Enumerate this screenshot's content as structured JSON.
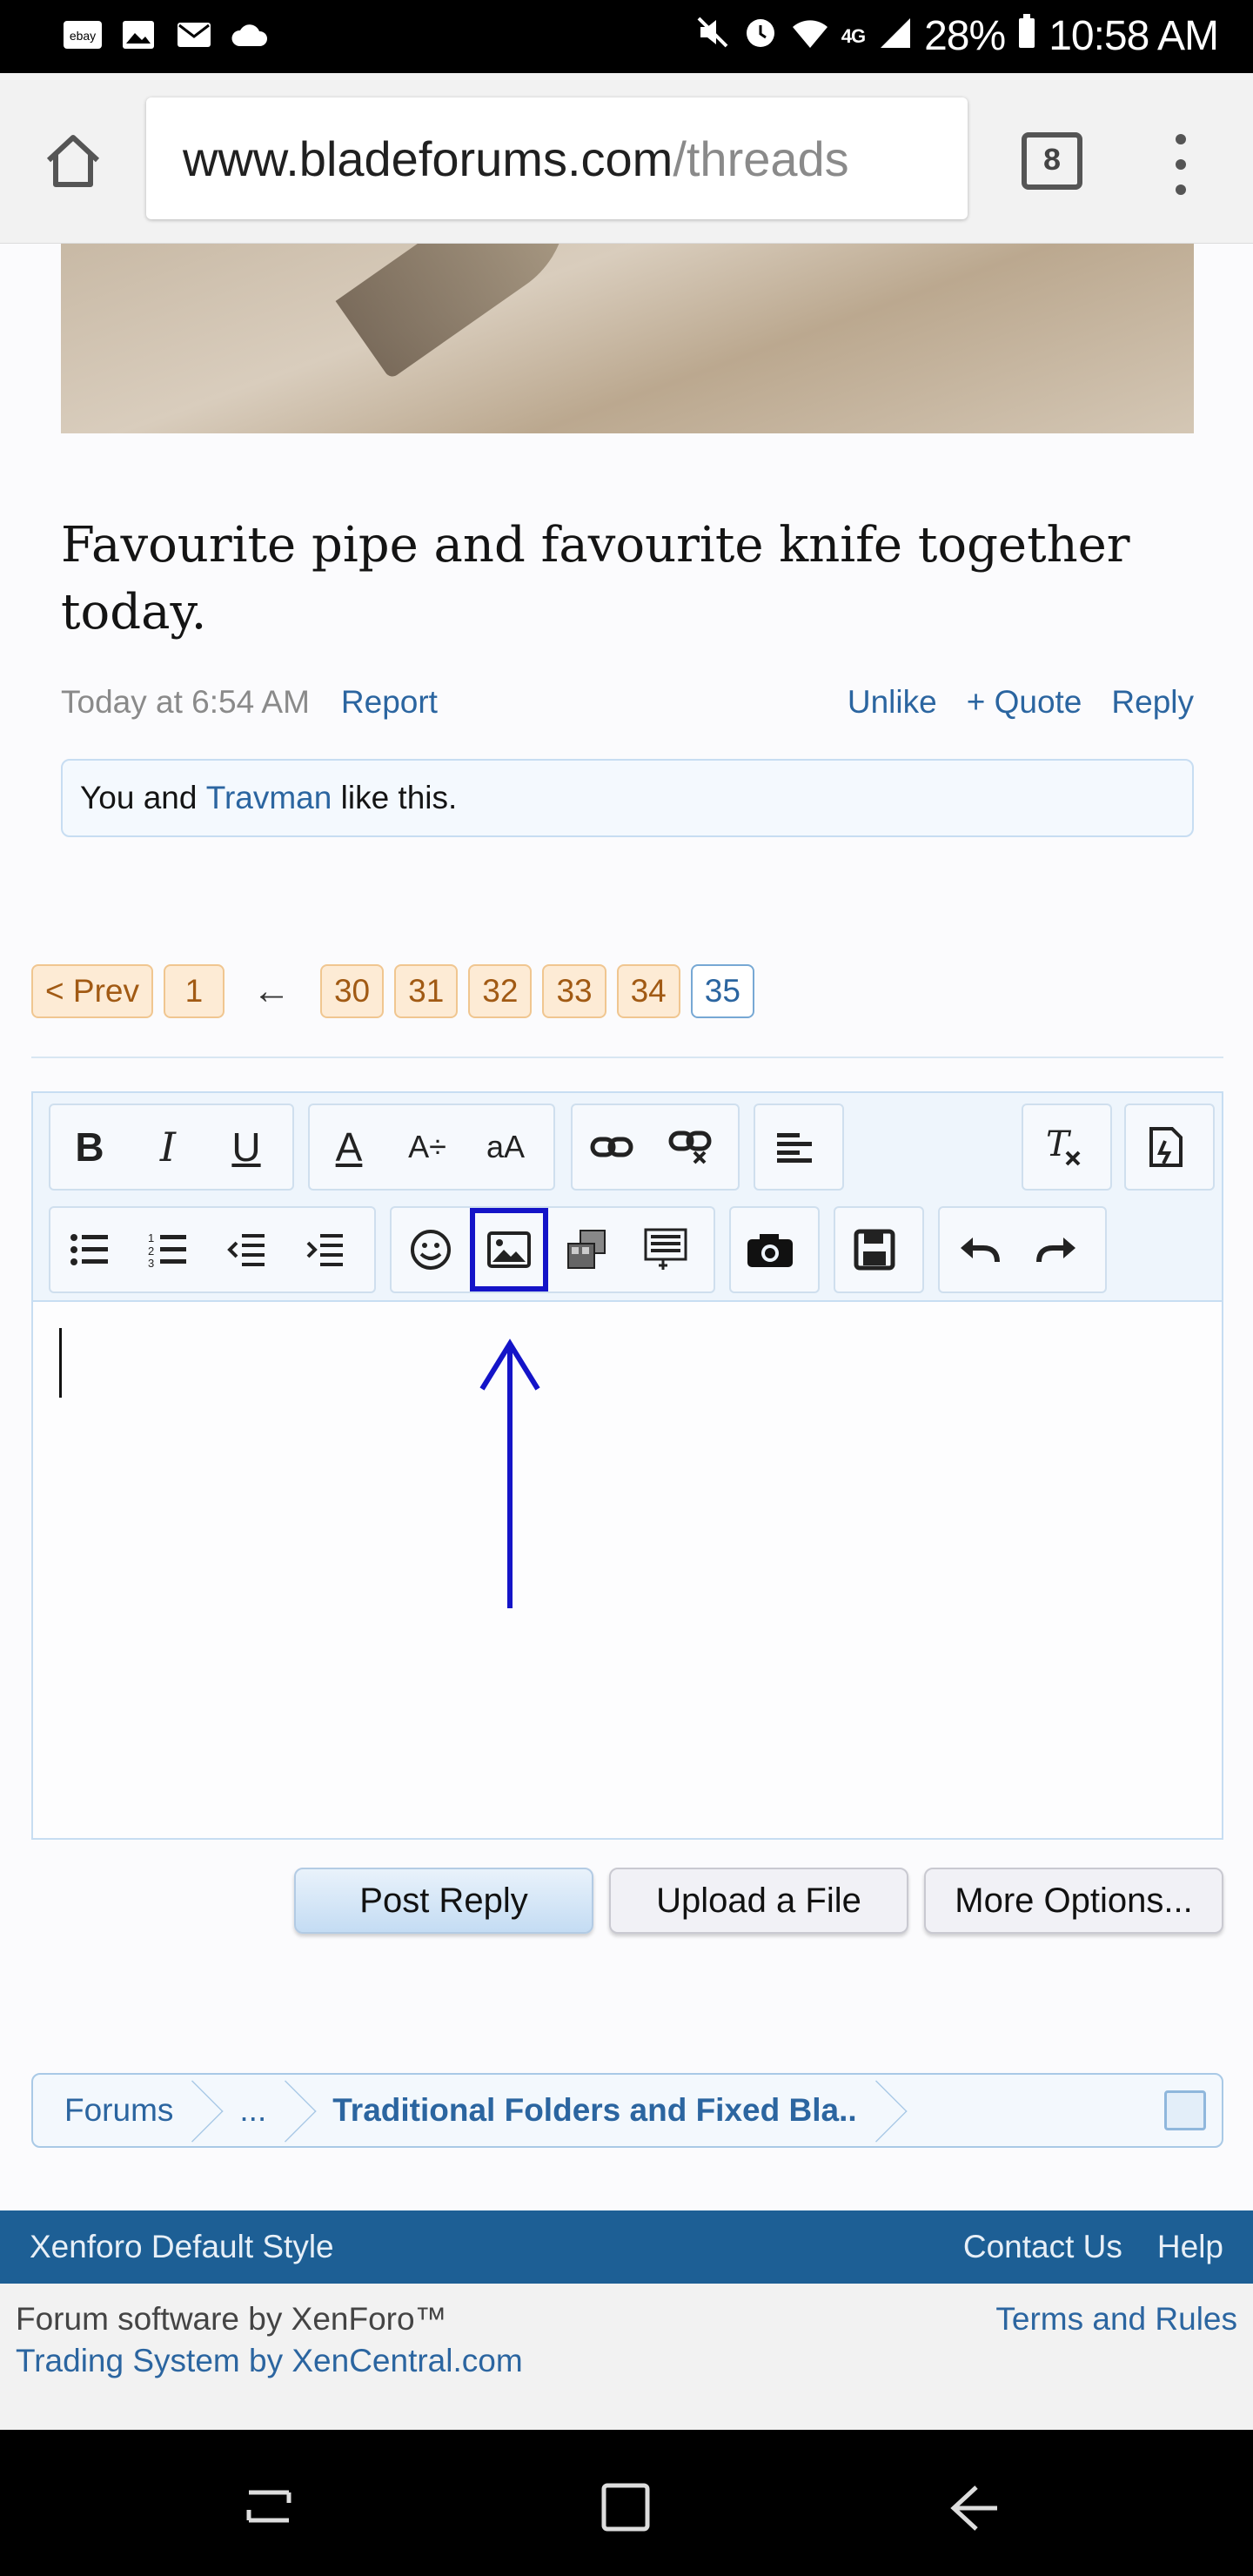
{
  "status_bar": {
    "battery": "28%",
    "time": "10:58 AM",
    "left_icons": [
      "ebay-icon",
      "image-icon",
      "mail-icon",
      "cloud-icon"
    ],
    "right_icons": [
      "mute-icon",
      "alarm-icon",
      "wifi-icon",
      "lte-icon",
      "signal-icon",
      "battery-icon"
    ]
  },
  "browser": {
    "url_host": "www.bladeforums.com",
    "url_path": "/threads",
    "tab_count": "8"
  },
  "post": {
    "text": "Favourite pipe and favourite knife together today.",
    "timestamp": "Today at 6:54 AM",
    "report": "Report",
    "unlike": "Unlike",
    "quote": "+ Quote",
    "reply": "Reply",
    "likes_prefix": "You and ",
    "likes_user": "Travman",
    "likes_suffix": " like this."
  },
  "pagination": {
    "prev": "< Prev",
    "first": "1",
    "jump": "←",
    "pages": [
      "30",
      "31",
      "32",
      "33",
      "34"
    ],
    "current": "35"
  },
  "editor": {
    "row1": {
      "format": [
        "B",
        "I",
        "U"
      ],
      "text_style": [
        "A",
        "A÷",
        "aA"
      ]
    }
  },
  "buttons": {
    "post_reply": "Post Reply",
    "upload": "Upload a File",
    "more": "More Options..."
  },
  "breadcrumb": {
    "forums": "Forums",
    "ellipsis": "...",
    "current": "Traditional Folders and Fixed Bla.."
  },
  "footer": {
    "style": "Xenforo Default Style",
    "contact": "Contact Us",
    "help": "Help",
    "software": "Forum software by XenForo™",
    "trading": "Trading System by XenCentral.com",
    "terms": "Terms and Rules"
  },
  "colors": {
    "link": "#2b65a0",
    "footer_bar": "#1d5f95",
    "annotation": "#1414c8"
  }
}
